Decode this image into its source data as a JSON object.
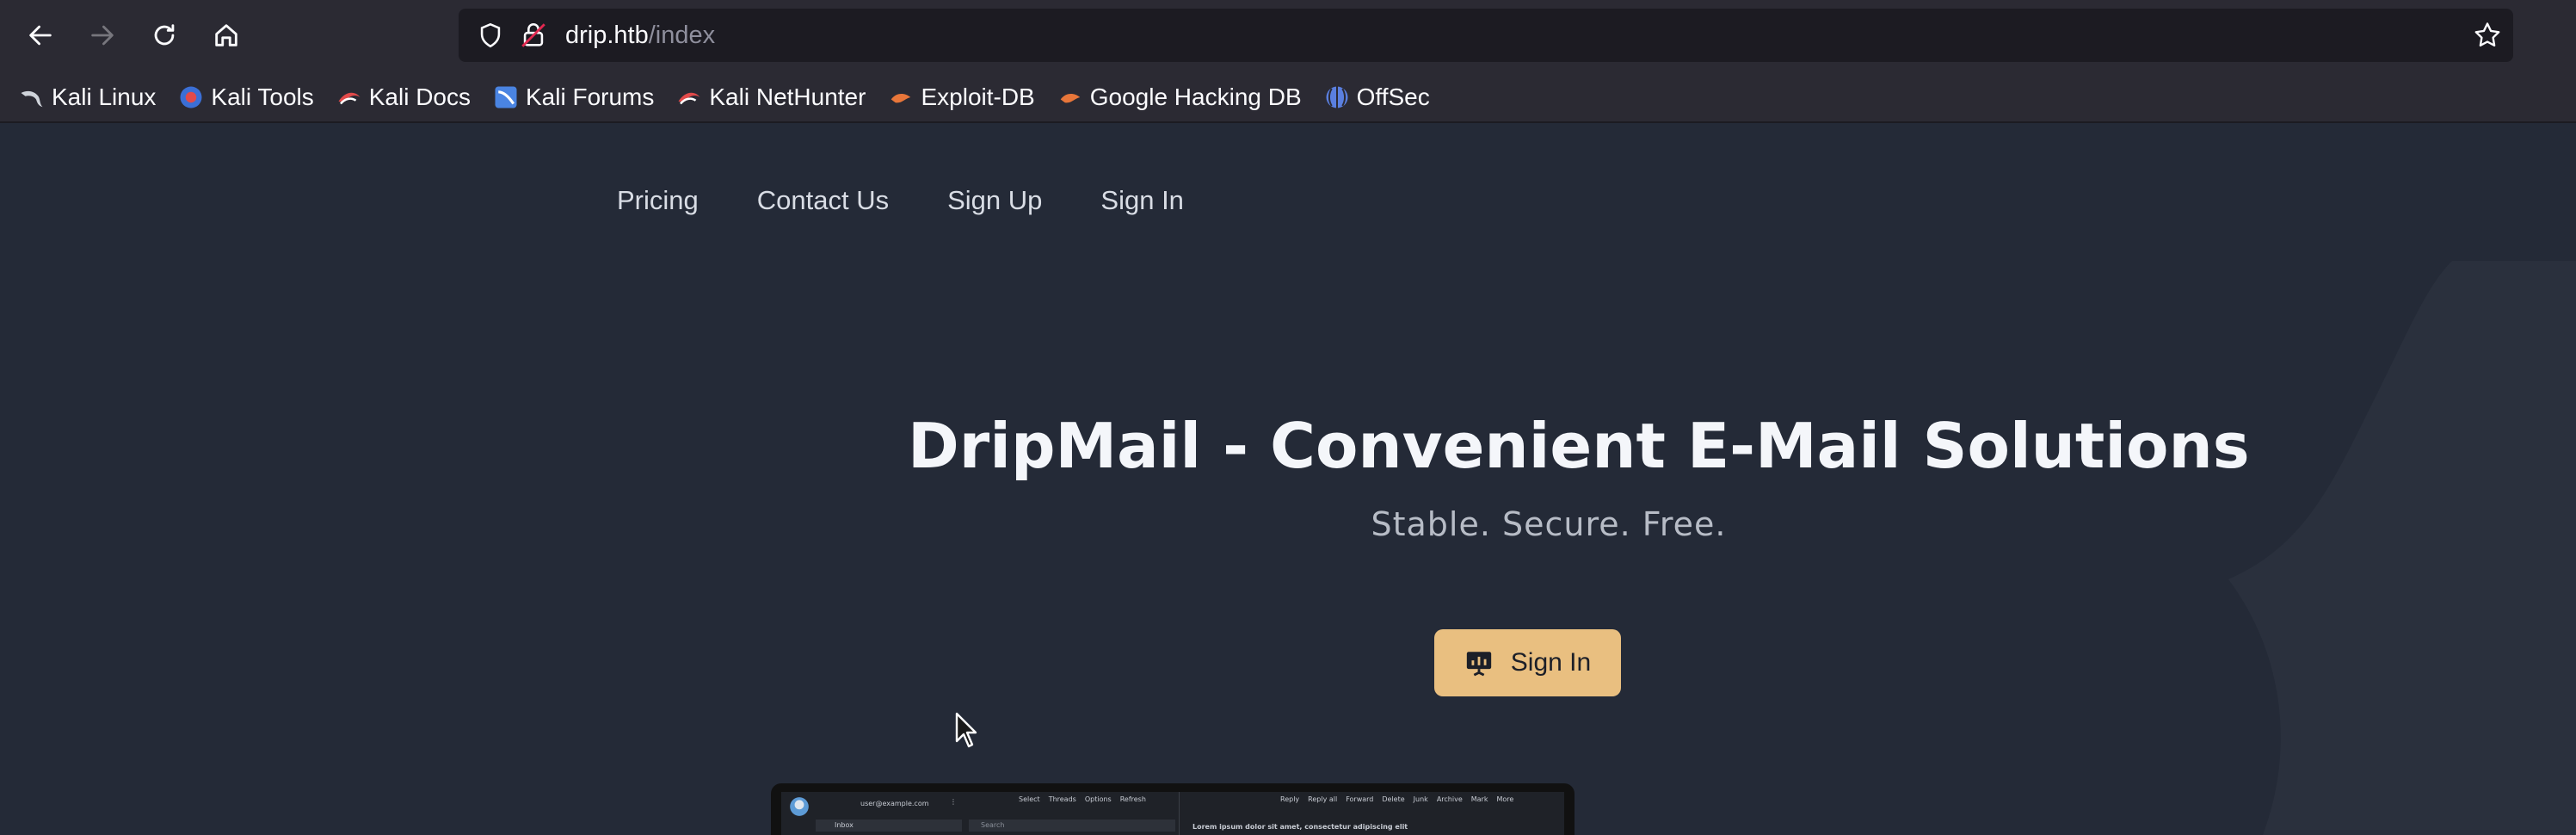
{
  "browser": {
    "url_host": "drip.htb",
    "url_path": "/index",
    "bookmarks": [
      {
        "label": "Kali Linux",
        "icon": "kali-dragon-icon"
      },
      {
        "label": "Kali Tools",
        "icon": "kali-tools-icon"
      },
      {
        "label": "Kali Docs",
        "icon": "kali-docs-icon"
      },
      {
        "label": "Kali Forums",
        "icon": "kali-forums-icon"
      },
      {
        "label": "Kali NetHunter",
        "icon": "kali-nethunter-icon"
      },
      {
        "label": "Exploit-DB",
        "icon": "exploit-db-icon"
      },
      {
        "label": "Google Hacking DB",
        "icon": "ghdb-icon"
      },
      {
        "label": "OffSec",
        "icon": "offsec-icon"
      }
    ]
  },
  "nav": {
    "pricing": "Pricing",
    "contact": "Contact Us",
    "signup": "Sign Up",
    "signin": "Sign In"
  },
  "hero": {
    "title": "DripMail - Convenient E-Mail Solutions",
    "subtitle": "Stable. Secure. Free.",
    "cta_label": "Sign In"
  },
  "preview": {
    "account": "user@example.com",
    "folder": "Inbox",
    "search_placeholder": "Search",
    "toolbar": [
      "Select",
      "Threads",
      "Options",
      "Refresh"
    ],
    "actions": [
      "Reply",
      "Reply all",
      "Forward",
      "Delete",
      "Junk",
      "Archive",
      "Mark",
      "More"
    ],
    "snippet": "Lorem ipsum dolor sit amet, consectetur adipiscing elit"
  },
  "colors": {
    "page_bg": "#242a37",
    "accent": "#e9bf80",
    "chrome_bg": "#2b2a33"
  }
}
